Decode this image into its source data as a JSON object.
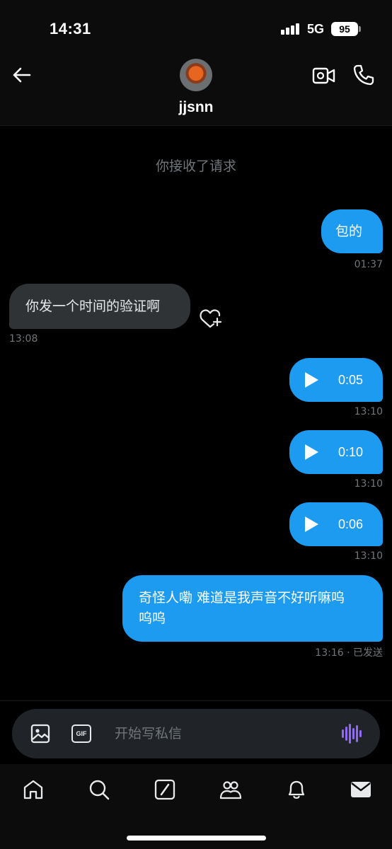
{
  "status_bar": {
    "time": "14:31",
    "network": "5G",
    "battery": "95"
  },
  "header": {
    "username": "jjsnn"
  },
  "system_message": "你接收了请求",
  "messages": [
    {
      "direction": "outgoing",
      "type": "text",
      "text": "包的",
      "time": "01:37"
    },
    {
      "direction": "incoming",
      "type": "text",
      "text": "你发一个时间的验证啊",
      "time": "13:08"
    },
    {
      "direction": "outgoing",
      "type": "voice",
      "duration": "0:05",
      "time": "13:10"
    },
    {
      "direction": "outgoing",
      "type": "voice",
      "duration": "0:10",
      "time": "13:10"
    },
    {
      "direction": "outgoing",
      "type": "voice",
      "duration": "0:06",
      "time": "13:10"
    },
    {
      "direction": "outgoing",
      "type": "text",
      "text_line1": "奇怪人嘞 难道是我声音不好听嘛呜",
      "text_line2": "呜呜",
      "time": "13:16 · 已发送"
    }
  ],
  "composer": {
    "placeholder": "开始写私信",
    "gif_label": "GIF"
  },
  "colors": {
    "accent": "#1d9bf0",
    "incoming_bubble": "#2f3336",
    "voice_icon": "#8f6bf5",
    "muted_text": "#71767b"
  },
  "icons": {
    "back": "arrow-left-icon",
    "video_call": "video-camera-icon",
    "voice_call": "phone-icon",
    "like": "heart-plus-icon",
    "image": "image-icon",
    "gif": "gif-icon",
    "voice_record": "waveform-icon",
    "nav": [
      "home-icon",
      "search-icon",
      "grok-icon",
      "communities-icon",
      "notifications-icon",
      "messages-icon"
    ]
  }
}
